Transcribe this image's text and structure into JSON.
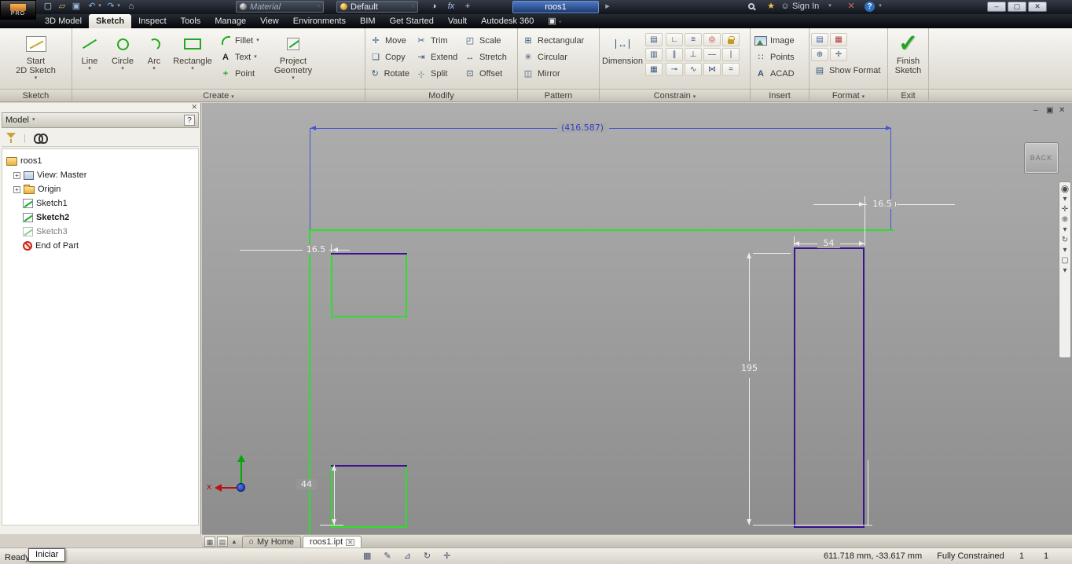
{
  "titlebar": {
    "logo": "PRO",
    "material": "Material",
    "appearance": "Default",
    "doc": "roos1",
    "sign_in": "Sign In"
  },
  "ribbon_tabs": [
    "3D Model",
    "Sketch",
    "Inspect",
    "Tools",
    "Manage",
    "View",
    "Environments",
    "BIM",
    "Get Started",
    "Vault",
    "Autodesk 360"
  ],
  "panels": {
    "sketch": {
      "label": "Sketch",
      "start1": "Start",
      "start2": "2D Sketch"
    },
    "create": {
      "label": "Create",
      "line": "Line",
      "circle": "Circle",
      "arc": "Arc",
      "rectangle": "Rectangle",
      "fillet": "Fillet",
      "text": "Text",
      "point": "Point",
      "proj1": "Project",
      "proj2": "Geometry"
    },
    "modify": {
      "label": "Modify",
      "move": "Move",
      "copy": "Copy",
      "rotate": "Rotate",
      "trim": "Trim",
      "extend": "Extend",
      "split": "Split",
      "scale": "Scale",
      "stretch": "Stretch",
      "offset": "Offset"
    },
    "pattern": {
      "label": "Pattern",
      "rectangular": "Rectangular",
      "circular": "Circular",
      "mirror": "Mirror"
    },
    "constrain": {
      "label": "Constrain",
      "dimension": "Dimension"
    },
    "insert": {
      "label": "Insert",
      "image": "Image",
      "points": "Points",
      "acad": "ACAD"
    },
    "format": {
      "label": "Format",
      "show_format": "Show Format"
    },
    "exit": {
      "label": "Exit",
      "finish1": "Finish",
      "finish2": "Sketch"
    }
  },
  "browser": {
    "header": "Model",
    "tree": [
      {
        "label": "roos1"
      },
      {
        "label": "View: Master"
      },
      {
        "label": "Origin"
      },
      {
        "label": "Sketch1"
      },
      {
        "label": "Sketch2"
      },
      {
        "label": "Sketch3"
      },
      {
        "label": "End of Part"
      }
    ]
  },
  "canvas": {
    "dim_width": "(416.587)",
    "dim_gap_top": "16.5",
    "dim_54": "54",
    "dim_gap_left": "16.5",
    "dim_195": "195",
    "dim_44": "44",
    "viewcube": "BACK",
    "axis_x": "x"
  },
  "doc_tabs": {
    "home": "My Home",
    "part": "roos1.ipt"
  },
  "statusbar": {
    "ready": "Ready",
    "iniciar": "Iniciar",
    "coords": "611.718 mm, -33.617 mm",
    "constrained": "Fully Constrained",
    "n1": "1",
    "n2": "1"
  },
  "colors": {
    "sketch_green": "#2be02b",
    "sketch_purple": "#3b138c",
    "dim_selected_blue": "#4455d2",
    "dim_white": "#ededed"
  },
  "icons": {
    "new_file": "▢",
    "open": "▱",
    "save": "▣",
    "undo": "↶",
    "redo": "↷",
    "home": "⌂",
    "caret": "▾",
    "caret_right": "▸",
    "fx": "fx",
    "plus": "+",
    "star": "★",
    "user": "☺",
    "x_mark": "✕",
    "help": "?",
    "win_min": "–",
    "win_max": "▢",
    "win_close": "✕",
    "text_a": "A",
    "point": "+",
    "move": "✛",
    "copy": "❏",
    "rotate": "↻",
    "trim": "✂",
    "extend": "⇥",
    "split": "-¦-",
    "scale": "◰",
    "stretch": "↔",
    "offset": "⊡",
    "rectangular": "⊞",
    "circular": "✳",
    "mirror": "◫",
    "dimension": "↔",
    "c_extra1": "▤",
    "c_extra2": "▥",
    "c_extra3": "▦",
    "coincident": "∟",
    "collinear": "≡",
    "concentric": "◎",
    "parallel": "∥",
    "perpendicular": "⊥",
    "horizontal": "―",
    "vertical": "∣",
    "tangent": "⊸",
    "smooth": "∿",
    "symmetric": "⋈",
    "equal": "=",
    "points": "∷",
    "acad_a": "A",
    "fmt1": "▤",
    "fmt2": "▦",
    "fmt3": "⊕",
    "fmt4": "✛",
    "check": "✓",
    "wheel": "◉",
    "pan": "✛",
    "zoom": "⊕",
    "orbit": "↻",
    "lookat": "▢",
    "pane_a": "▦",
    "pane_b": "▤",
    "pane_up": "▲",
    "tab_close": "✕",
    "doc_min": "–",
    "doc_restore": "▣",
    "doc_close": "✕",
    "st1": "▦",
    "st2": "✎",
    "st3": "⊿",
    "st4": "↻",
    "st5": "✛",
    "expand": "+"
  }
}
